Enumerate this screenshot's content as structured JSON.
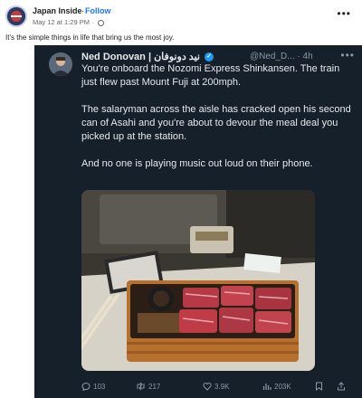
{
  "post": {
    "page_name": "Japan Inside",
    "dot": "·",
    "follow_label": "Follow",
    "timestamp": "May 12 at 1:29 PM",
    "meta_dot": "·",
    "caption": "It's the simple things in life that bring us the most joy."
  },
  "tweet": {
    "author_name": "Ned Donovan | نيد دونوفان",
    "handle": "@Ned_D...",
    "dot": "·",
    "time_ago": "4h",
    "paragraphs": [
      "You're onboard the Nozomi Express Shinkansen. The train just flew past Mount Fuji at 200mph.",
      "The salaryman across the aisle has cracked open his second can of Asahi and you're about to devour the meal deal you picked up at the station.",
      "And no one is playing music out loud on their phone."
    ],
    "stats": {
      "replies": "103",
      "retweets": "217",
      "likes": "3.9K",
      "views": "203K"
    }
  },
  "colors": {
    "tweet_bg": "#15202b",
    "accent": "#1d9bf0",
    "follow": "#1877f2"
  }
}
